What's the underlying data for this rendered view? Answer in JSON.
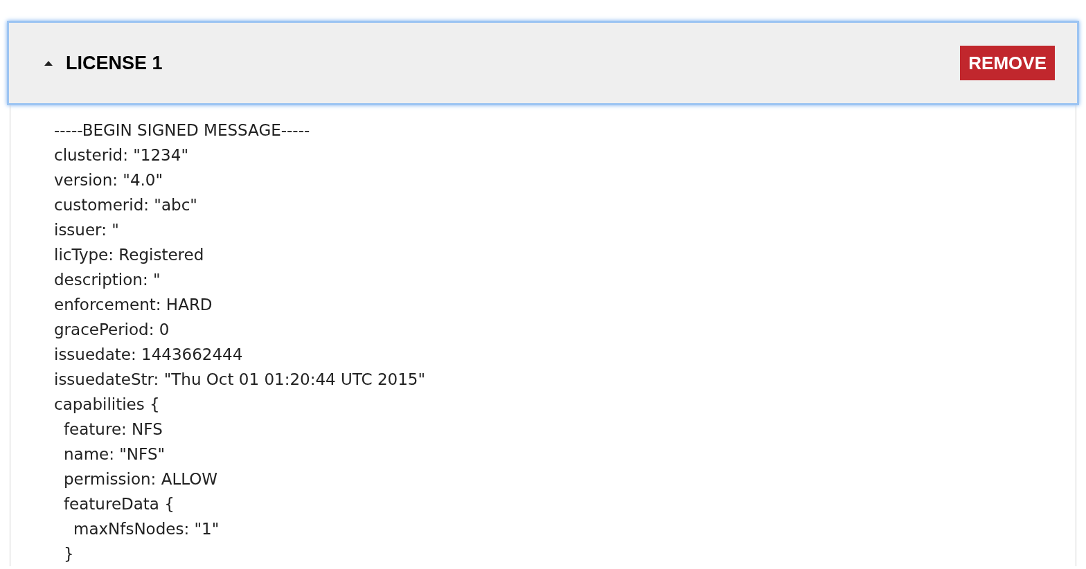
{
  "panel": {
    "title": "LICENSE 1",
    "expanded": true,
    "remove_button": "REMOVE"
  },
  "lines": [
    {
      "text": "-----BEGIN SIGNED MESSAGE-----"
    },
    {
      "text": "clusterid: \"1234\""
    },
    {
      "text": "version: \"4.0\""
    },
    {
      "text": "customerid: \"abc\""
    },
    {
      "text": "issuer: \""
    },
    {
      "text": "licType: Registered"
    },
    {
      "text": "description: \""
    },
    {
      "text": "enforcement: HARD"
    },
    {
      "text": "gracePeriod: 0"
    },
    {
      "text": "issuedate: 1443662444"
    },
    {
      "text": "issuedateStr: \"Thu Oct 01 01:20:44 UTC 2015\""
    },
    {
      "text": "capabilities {",
      "children": [
        {
          "text": "feature: NFS"
        },
        {
          "text": "name: \"NFS\""
        },
        {
          "text": "permission: ALLOW"
        },
        {
          "text": "featureData {",
          "children": [
            {
              "text": "maxNfsNodes: \"1\""
            }
          ]
        },
        {
          "text": "}"
        }
      ]
    }
  ]
}
